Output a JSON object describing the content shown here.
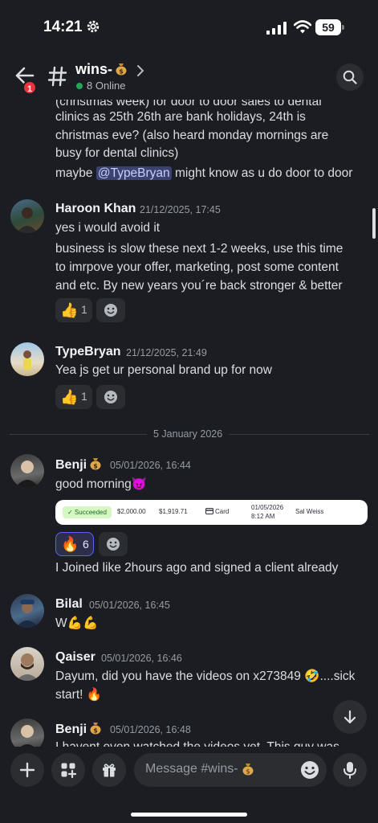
{
  "status_bar": {
    "time": "14:21",
    "battery": "59"
  },
  "header": {
    "notification_count": "1",
    "channel_name": "wins-",
    "online_text": "8 Online",
    "icons": [
      "back-arrow-icon",
      "hash-icon",
      "chevron-right-icon",
      "search-icon",
      "money-bag-emoji"
    ]
  },
  "messages": {
    "prev": {
      "line0": "(christmas week) for door to door sales to dental",
      "line1": "clinics as 25th 26th are bank holidays, 24th is",
      "line2": "christmas eve? (also heard monday mornings are",
      "line3": "busy for dental clinics)",
      "line4_pre": "maybe ",
      "mention": "@TypeBryan",
      "line4_post": " might know as u do door to door"
    },
    "haroon": {
      "name": "Haroon Khan",
      "time": "21/12/2025, 17:45",
      "line0": "yes i would avoid it",
      "line1": "business is slow these next 1-2 weeks, use this time",
      "line2": "to imrpove your offer, marketing, post some content",
      "line3": "and etc. By new years you´re back stronger & better",
      "reaction_emoji": "👍",
      "reaction_count": "1"
    },
    "bryan": {
      "name": "TypeBryan",
      "time": "21/12/2025, 21:49",
      "line0": "Yea js get ur personal brand up for now",
      "reaction_emoji": "👍",
      "reaction_count": "1"
    },
    "date_divider": "5 January 2026",
    "benji": {
      "name": "Benji",
      "time": "05/01/2026, 16:44",
      "line0": "good morning",
      "line0_emoji": "😈",
      "receipt": {
        "status": "✓ Succeeded",
        "amount": "$2,000.00",
        "net": "$1,919.71",
        "method": "Card",
        "date": "01/05/2026",
        "time": "8:12 AM",
        "customer": "Sal Weiss"
      },
      "reaction_emoji": "🔥",
      "reaction_count": "6",
      "line1": "I Joined like 2hours ago and signed a client already"
    },
    "bilal": {
      "name": "Bilal",
      "time": "05/01/2026, 16:45",
      "line0": "W",
      "line0_emoji": "💪💪"
    },
    "qaiser": {
      "name": "Qaiser",
      "time": "05/01/2026, 16:46",
      "line0": "Dayum, did you have the videos on x273849 🤣....sick",
      "line1": "start! 🔥"
    },
    "benji2": {
      "name": "Benji",
      "time": "05/01/2026, 16:48",
      "line0": "I havent even watched the videos yet. This guy was"
    }
  },
  "composer": {
    "placeholder": "Message #wins-",
    "icons": [
      "plus-icon",
      "apps-icon",
      "gift-icon",
      "emoji-icon",
      "microphone-icon"
    ]
  },
  "colors": {
    "background": "#1c1d22",
    "surface": "#2b2d31",
    "accent": "#5865f2",
    "online": "#23a55a",
    "badge": "#e5353b"
  }
}
